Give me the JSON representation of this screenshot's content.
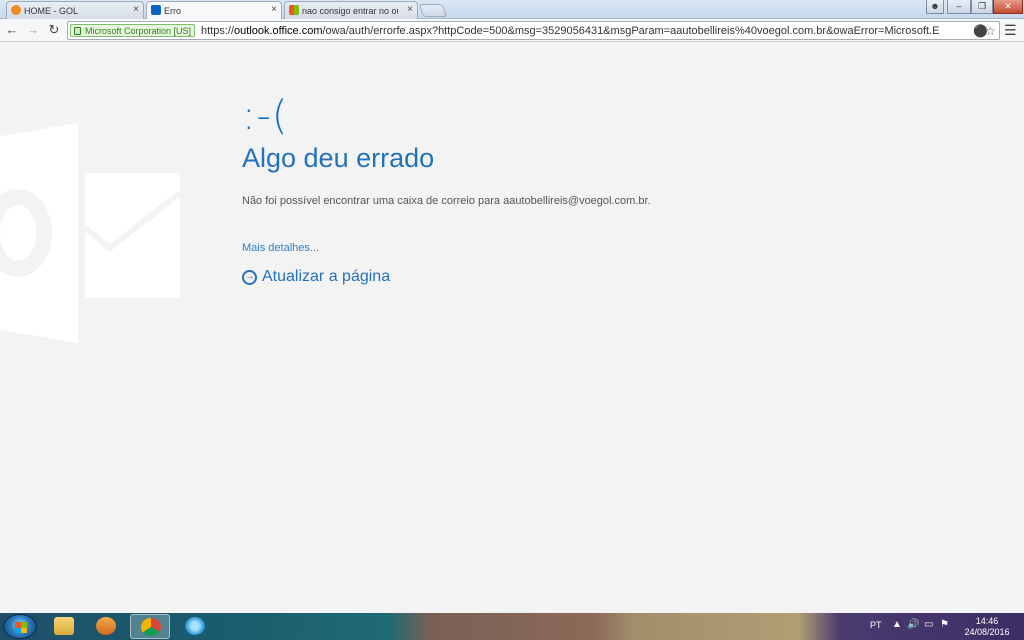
{
  "browser": {
    "tabs": [
      {
        "title": "HOME - GOL",
        "close": "×"
      },
      {
        "title": "Erro",
        "close": "×"
      },
      {
        "title": "nao consigo entrar no outl",
        "close": "×"
      }
    ],
    "security_badge": "Microsoft Corporation [US]",
    "url_scheme": "https://",
    "url_host": "outlook.office.com",
    "url_path": "/owa/auth/errorfe.aspx?httpCode=500&msg=3529056431&msgParam=aautobellireis%40voegol.com.br&owaError=Microsoft.E"
  },
  "page": {
    "emoticon": ":-(",
    "heading": "Algo deu errado",
    "message": "Não foi possível encontrar uma caixa de correio para aautobellireis@voegol.com.br.",
    "details_link": "Mais detalhes...",
    "refresh_link": "Atualizar a página"
  },
  "taskbar": {
    "language": "PT",
    "time": "14:46",
    "date": "24/08/2016"
  },
  "colors": {
    "accent": "#2372ba",
    "link": "#2f7fc1",
    "background": "#f3f3f3"
  }
}
